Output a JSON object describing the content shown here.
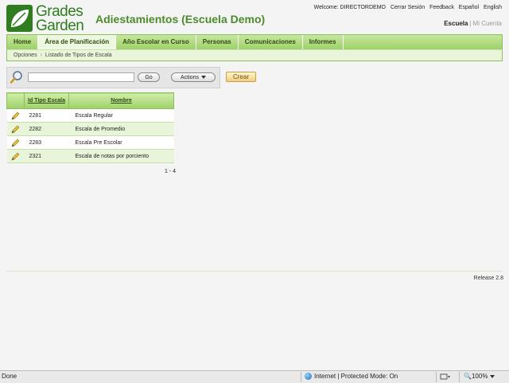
{
  "logo": {
    "line1": "Grades",
    "line2": "Garden"
  },
  "app_title": "Adiestamientos (Escuela Demo)",
  "top_links": {
    "welcome": "Welcome: DIRECTORDEMO",
    "logout": "Cerrar Sesión",
    "feedback": "Feedback",
    "spanish": "Español",
    "english": "English"
  },
  "context": {
    "active": "Escuela",
    "inactive": "Mi Cuenta"
  },
  "nav": {
    "tabs": [
      {
        "label": "Home"
      },
      {
        "label": "Área de Planificación"
      },
      {
        "label": "Año Escolar en Curso"
      },
      {
        "label": "Personas"
      },
      {
        "label": "Comunicaciones"
      },
      {
        "label": "Informes"
      }
    ],
    "active_index": 1
  },
  "breadcrumb": {
    "items": [
      "Opciones",
      "Listado de Tipos de Escala"
    ]
  },
  "search": {
    "value": "",
    "go_label": "Go",
    "actions_label": "Actions",
    "crear_label": "Crear"
  },
  "table": {
    "headers": {
      "id": "Id Tipo Escala",
      "name": "Nombre"
    },
    "rows": [
      {
        "id": "2281",
        "name": "Escala Regular"
      },
      {
        "id": "2282",
        "name": "Escala de Promedio"
      },
      {
        "id": "2283",
        "name": "Escala Pre Escolar"
      },
      {
        "id": "2321",
        "name": "Escala de notas por porciento"
      }
    ]
  },
  "pager": "1 - 4",
  "release": "Release 2.8",
  "statusbar": {
    "done": "Done",
    "zone": "Internet | Protected Mode: On",
    "zoom": "100%"
  },
  "colors": {
    "brand_green": "#2f7d1e",
    "nav_green": "#9fd16a",
    "row_alt": "#e8f5d8"
  }
}
